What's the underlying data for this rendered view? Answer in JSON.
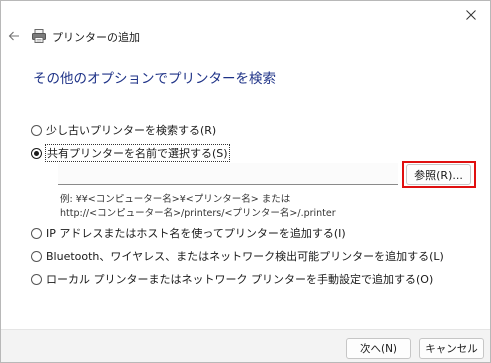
{
  "window": {
    "title": "プリンターの追加",
    "icons": {
      "back": "back-arrow-icon",
      "printer": "printer-icon",
      "close": "close-icon"
    }
  },
  "heading": "その他のオプションでプリンターを検索",
  "options": [
    {
      "label": "少し古いプリンターを検索する(R)",
      "selected": false
    },
    {
      "label": "共有プリンターを名前で選択する(S)",
      "selected": true
    },
    {
      "label": "IP アドレスまたはホスト名を使ってプリンターを追加する(I)",
      "selected": false
    },
    {
      "label": "Bluetooth、ワイヤレス、またはネットワーク検出可能プリンターを追加する(L)",
      "selected": false
    },
    {
      "label": "ローカル プリンターまたはネットワーク プリンターを手動設定で追加する(O)",
      "selected": false
    }
  ],
  "share_input": {
    "value": "",
    "placeholder": ""
  },
  "browse_button": "参照(R)...",
  "hint_lines": [
    "例: ¥¥<コンピューター名>¥<プリンター名> または",
    "http://<コンピューター名>/printers/<プリンター名>/.printer"
  ],
  "footer": {
    "next": "次へ(N)",
    "cancel": "キャンセル"
  },
  "colors": {
    "heading": "#1e3287",
    "highlight": "#e01010"
  }
}
